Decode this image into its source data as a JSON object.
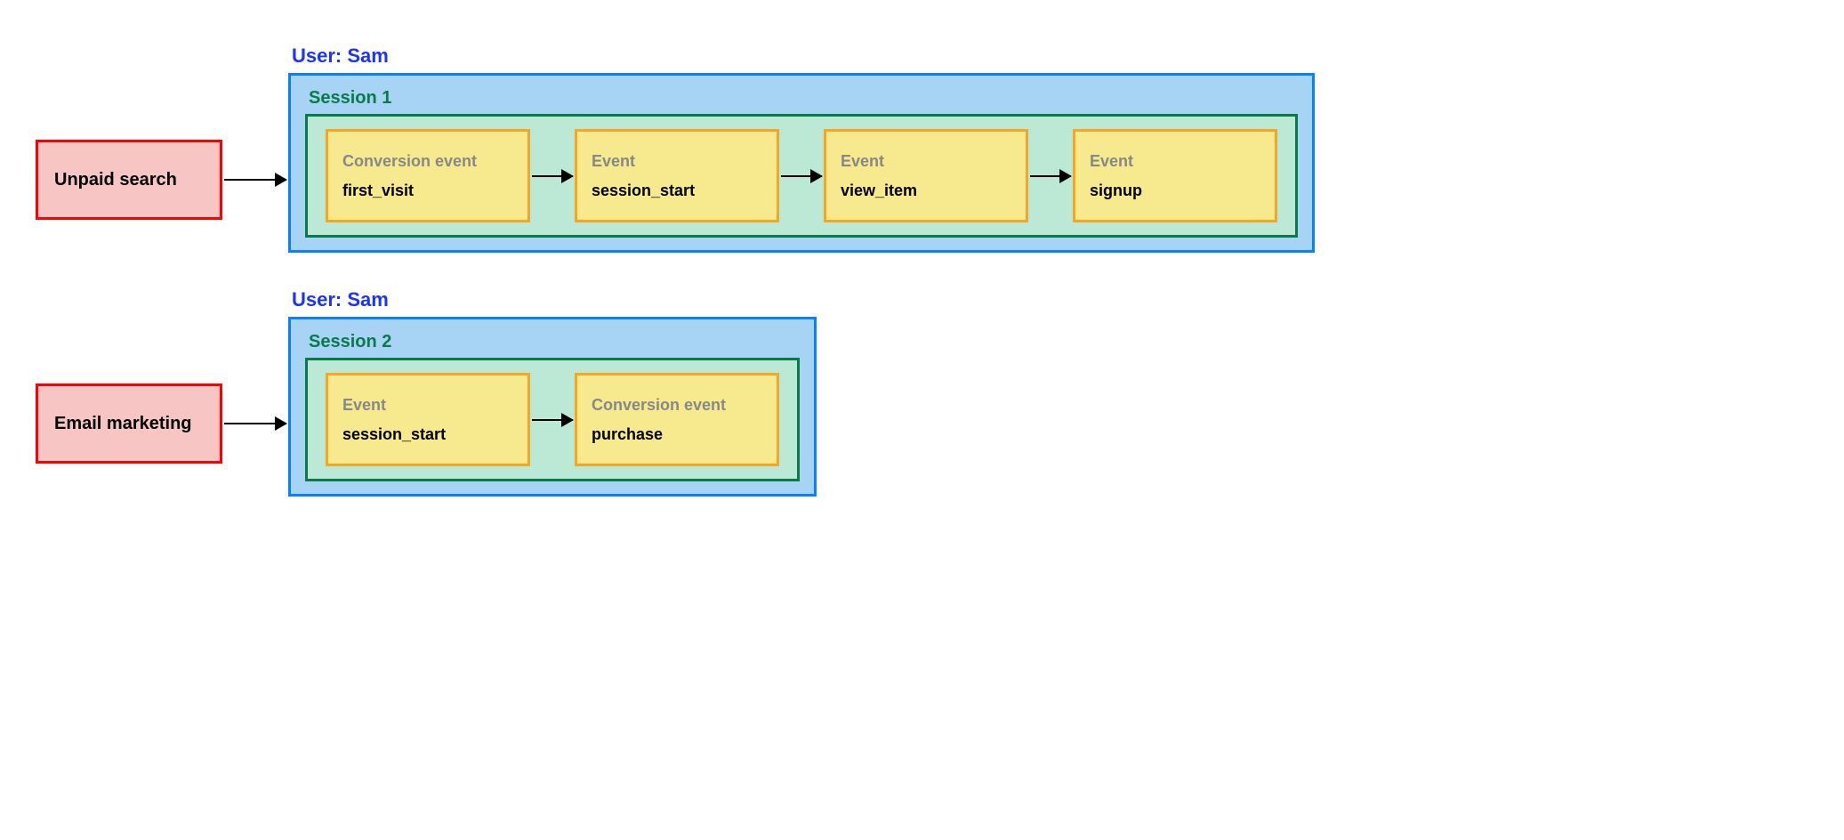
{
  "flows": [
    {
      "source": "Unpaid search",
      "user_label": "User: Sam",
      "session_label": "Session 1",
      "events": [
        {
          "type": "Conversion event",
          "name": "first_visit"
        },
        {
          "type": "Event",
          "name": "session_start"
        },
        {
          "type": "Event",
          "name": "view_item"
        },
        {
          "type": "Event",
          "name": "signup"
        }
      ]
    },
    {
      "source": "Email marketing",
      "user_label": "User: Sam",
      "session_label": "Session 2",
      "events": [
        {
          "type": "Event",
          "name": "session_start"
        },
        {
          "type": "Conversion event",
          "name": "purchase"
        }
      ]
    }
  ]
}
